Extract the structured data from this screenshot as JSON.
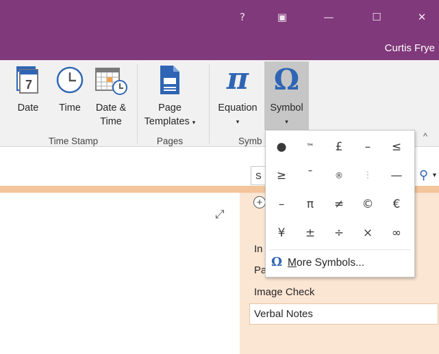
{
  "titlebar": {
    "help_label": "?",
    "restore_ribbon_label": "▣",
    "minimize_label": "—",
    "maximize_label": "☐",
    "close_label": "✕",
    "user_name": "Curtis Frye"
  },
  "ribbon": {
    "buttons": {
      "date": "Date",
      "time": "Time",
      "date_time_1": "Date &",
      "date_time_2": "Time",
      "page_templates_1": "Page",
      "page_templates_2": "Templates",
      "equation": "Equation",
      "symbol": "Symbol"
    },
    "groups": {
      "time_stamp": "Time Stamp",
      "pages": "Pages",
      "symbols": "Symb"
    },
    "calendar_day": "7"
  },
  "search": {
    "placeholder": "S"
  },
  "pages_panel": {
    "items": [
      "In",
      "Pa",
      "Image Check",
      "Verbal Notes"
    ]
  },
  "symbol_gallery": {
    "symbols": [
      [
        "●",
        "™",
        "£",
        "–",
        "≤"
      ],
      [
        "≥",
        "¯",
        "®",
        "⋮",
        "—"
      ],
      [
        "–",
        "π",
        "≠",
        "©",
        "€"
      ],
      [
        "¥",
        "±",
        "÷",
        "×",
        "∞"
      ]
    ],
    "more_accel": "M",
    "more_rest": "ore Symbols...",
    "more_icon": "Ω"
  },
  "colors": {
    "titlebar": "#80397b",
    "accent_blue": "#2f65b4",
    "pages_bg": "#fbe5d3",
    "orange_band": "#f4c49b"
  }
}
